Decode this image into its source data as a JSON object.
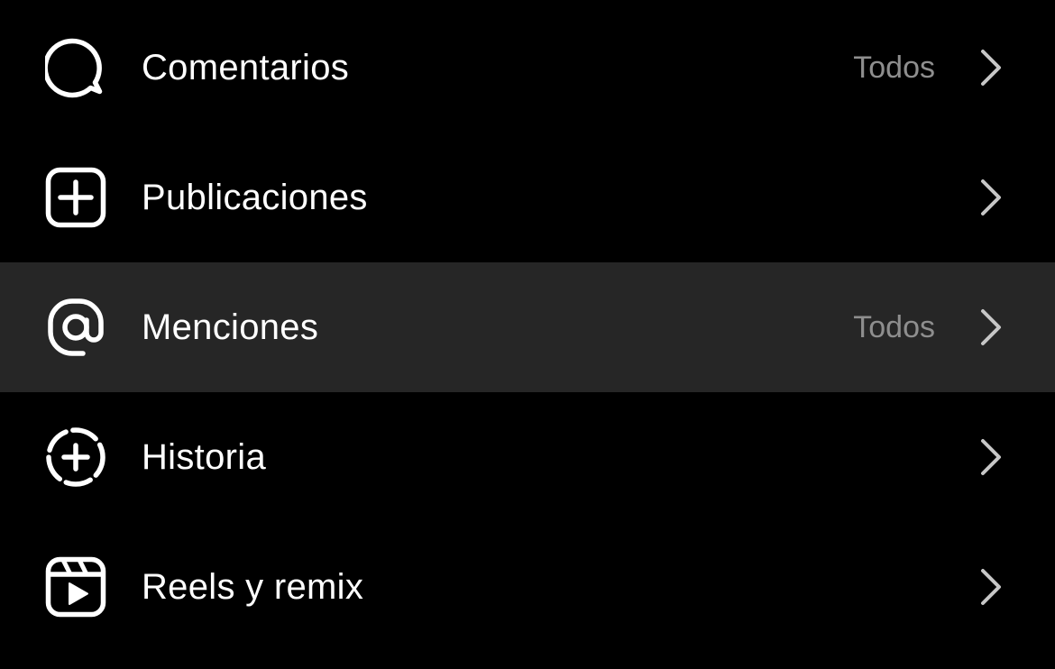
{
  "colors": {
    "background": "#000000",
    "highlight_row": "#262626",
    "text_primary": "#ffffff",
    "text_secondary": "#8e8e8e",
    "chevron": "#c7c7c7"
  },
  "items": [
    {
      "label": "Comentarios",
      "value": "Todos",
      "icon": "comment-bubble-icon"
    },
    {
      "label": "Publicaciones",
      "value": "",
      "icon": "add-square-icon"
    },
    {
      "label": "Menciones",
      "value": "Todos",
      "icon": "at-sign-icon",
      "highlighted": true
    },
    {
      "label": "Historia",
      "value": "",
      "icon": "add-story-icon"
    },
    {
      "label": "Reels y remix",
      "value": "",
      "icon": "reels-icon"
    }
  ]
}
